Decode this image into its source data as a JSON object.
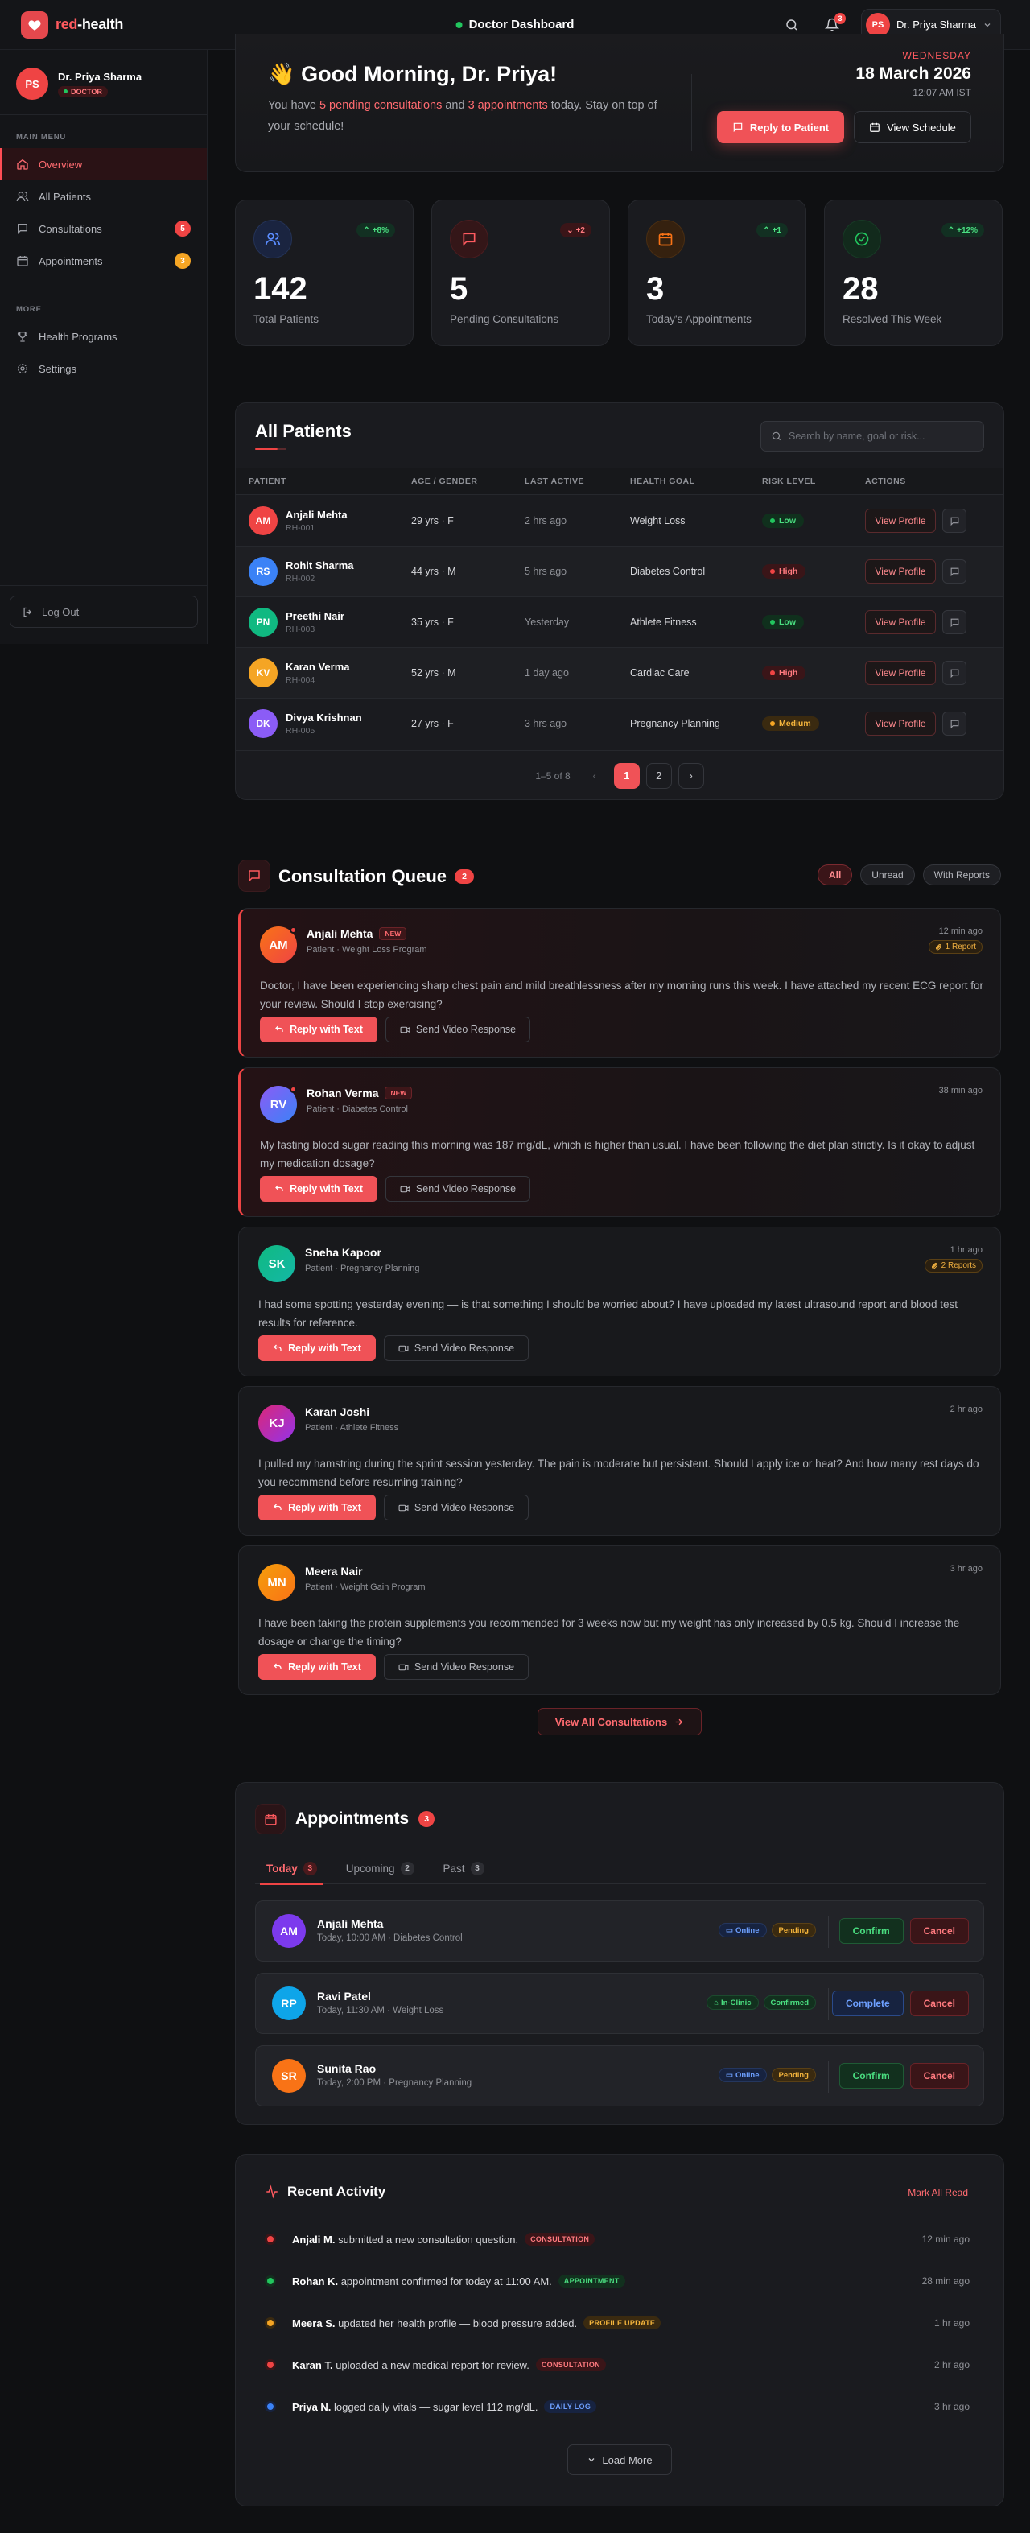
{
  "header": {
    "brand_prefix": "red",
    "brand_suffix": "-health",
    "title": "Doctor Dashboard",
    "notifications_count": "3",
    "user_initials": "PS",
    "user_name": "Dr. Priya Sharma"
  },
  "sidebar": {
    "profile": {
      "initials": "PS",
      "name": "Dr. Priya Sharma",
      "role": "DOCTOR"
    },
    "main_menu_label": "MAIN MENU",
    "more_label": "MORE",
    "items": [
      {
        "label": "Overview"
      },
      {
        "label": "All Patients"
      },
      {
        "label": "Consultations",
        "count": "5"
      },
      {
        "label": "Appointments",
        "count": "3"
      },
      {
        "label": "Health Programs"
      },
      {
        "label": "Settings"
      }
    ],
    "logout_label": "Log Out"
  },
  "greeting": {
    "wave": "👋",
    "title": "Good Morning, Dr. Priya!",
    "text_1": "You have ",
    "pending": "5 pending consultations",
    "text_2": " and ",
    "appointments": "3 appointments",
    "text_3": " today. Stay on top of your schedule!",
    "day": "WEDNESDAY",
    "date": "18 March 2026",
    "time": "12:07 AM IST",
    "reply_button": "Reply to Patient",
    "schedule_button": "View Schedule"
  },
  "stats": [
    {
      "value": "142",
      "label": "Total Patients",
      "trend": "+8%",
      "icon": "users-icon",
      "color": "#3b82f6"
    },
    {
      "value": "5",
      "label": "Pending Consultations",
      "trend": "+2",
      "icon": "message-icon",
      "color": "#ef4444"
    },
    {
      "value": "3",
      "label": "Today's Appointments",
      "trend": "+1",
      "icon": "calendar-icon",
      "color": "#f97316"
    },
    {
      "value": "28",
      "label": "Resolved This Week",
      "trend": "+12%",
      "icon": "check-circle-icon",
      "color": "#22c55e"
    }
  ],
  "patients": {
    "title": "All Patients",
    "search_placeholder": "Search by name, goal or risk...",
    "columns": [
      "PATIENT",
      "AGE / GENDER",
      "LAST ACTIVE",
      "HEALTH GOAL",
      "RISK LEVEL",
      "ACTIONS"
    ],
    "rows": [
      {
        "initials": "AM",
        "name": "Anjali Mehta",
        "id": "RH-001",
        "age": "29 yrs · F",
        "last": "2 hrs ago",
        "goal": "Weight Loss",
        "risk": "Low",
        "color": "#ef4444"
      },
      {
        "initials": "RS",
        "name": "Rohit Sharma",
        "id": "RH-002",
        "age": "44 yrs · M",
        "last": "5 hrs ago",
        "goal": "Diabetes Control",
        "risk": "High",
        "color": "#3b82f6"
      },
      {
        "initials": "PN",
        "name": "Preethi Nair",
        "id": "RH-003",
        "age": "35 yrs · F",
        "last": "Yesterday",
        "goal": "Athlete Fitness",
        "risk": "Low",
        "color": "#10b981"
      },
      {
        "initials": "KV",
        "name": "Karan Verma",
        "id": "RH-004",
        "age": "52 yrs · M",
        "last": "1 day ago",
        "goal": "Cardiac Care",
        "risk": "High",
        "color": "#f5a524"
      },
      {
        "initials": "DK",
        "name": "Divya Krishnan",
        "id": "RH-005",
        "age": "27 yrs · F",
        "last": "3 hrs ago",
        "goal": "Pregnancy Planning",
        "risk": "Medium",
        "color": "#8b5cf6"
      }
    ],
    "view_profile_label": "View Profile",
    "pager_info": "1–5 of 8",
    "pages": [
      "1",
      "2"
    ]
  },
  "queue": {
    "title": "Consultation Queue",
    "count": "2",
    "filters": [
      "All",
      "Unread",
      "With Reports"
    ],
    "reply_label": "Reply with Text",
    "video_label": "Send Video Response",
    "new_label": "NEW",
    "items": [
      {
        "initials": "AM",
        "name": "Anjali Mehta",
        "sub": "Patient · Weight Loss Program",
        "time": "12 min ago",
        "report": "1 Report",
        "message": "Doctor, I have been experiencing sharp chest pain and mild breathlessness after my morning runs this week. I have attached my recent ECG report for your review. Should I stop exercising?"
      },
      {
        "initials": "RV",
        "name": "Rohan Verma",
        "sub": "Patient · Diabetes Control",
        "time": "38 min ago",
        "report": "",
        "message": "My fasting blood sugar reading this morning was 187 mg/dL, which is higher than usual. I have been following the diet plan strictly. Is it okay to adjust my medication dosage?"
      },
      {
        "initials": "SK",
        "name": "Sneha Kapoor",
        "sub": "Patient · Pregnancy Planning",
        "time": "1 hr ago",
        "report": "2 Reports",
        "message": "I had some spotting yesterday evening — is that something I should be worried about? I have uploaded my latest ultrasound report and blood test results for reference."
      },
      {
        "initials": "KJ",
        "name": "Karan Joshi",
        "sub": "Patient · Athlete Fitness",
        "time": "2 hr ago",
        "report": "",
        "message": "I pulled my hamstring during the sprint session yesterday. The pain is moderate but persistent. Should I apply ice or heat? And how many rest days do you recommend before resuming training?"
      },
      {
        "initials": "MN",
        "name": "Meera Nair",
        "sub": "Patient · Weight Gain Program",
        "time": "3 hr ago",
        "report": "",
        "message": "I have been taking the protein supplements you recommended for 3 weeks now but my weight has only increased by 0.5 kg. Should I increase the dosage or change the timing?"
      }
    ],
    "view_all": "View All Consultations"
  },
  "appointments": {
    "title": "Appointments",
    "count": "3",
    "tabs": [
      {
        "label": "Today",
        "count": "3"
      },
      {
        "label": "Upcoming",
        "count": "2"
      },
      {
        "label": "Past",
        "count": "3"
      }
    ],
    "items": [
      {
        "initials": "AM",
        "name": "Anjali Mehta",
        "meta": "Today, 10:00 AM · Diabetes Control",
        "mode": "Online",
        "status": "Pending",
        "primary": "Confirm",
        "secondary": "Cancel"
      },
      {
        "initials": "RP",
        "name": "Ravi Patel",
        "meta": "Today, 11:30 AM · Weight Loss",
        "mode": "In-Clinic",
        "status": "Confirmed",
        "primary": "Complete",
        "secondary": "Cancel"
      },
      {
        "initials": "SR",
        "name": "Sunita Rao",
        "meta": "Today, 2:00 PM · Pregnancy Planning",
        "mode": "Online",
        "status": "Pending",
        "primary": "Confirm",
        "secondary": "Cancel"
      }
    ]
  },
  "activity": {
    "title": "Recent Activity",
    "mark_read": "Mark All Read",
    "items": [
      {
        "who": "Anjali M.",
        "what": "submitted a new consultation question.",
        "tag": "CONSULTATION",
        "time": "12 min ago"
      },
      {
        "who": "Rohan K.",
        "what": "appointment confirmed for today at 11:00 AM.",
        "tag": "APPOINTMENT",
        "time": "28 min ago"
      },
      {
        "who": "Meera S.",
        "what": "updated her health profile — blood pressure added.",
        "tag": "PROFILE UPDATE",
        "time": "1 hr ago"
      },
      {
        "who": "Karan T.",
        "what": "uploaded a new medical report for review.",
        "tag": "CONSULTATION",
        "time": "2 hr ago"
      },
      {
        "who": "Priya N.",
        "what": "logged daily vitals — sugar level 112 mg/dL.",
        "tag": "DAILY LOG",
        "time": "3 hr ago"
      }
    ],
    "load_more": "Load More"
  }
}
